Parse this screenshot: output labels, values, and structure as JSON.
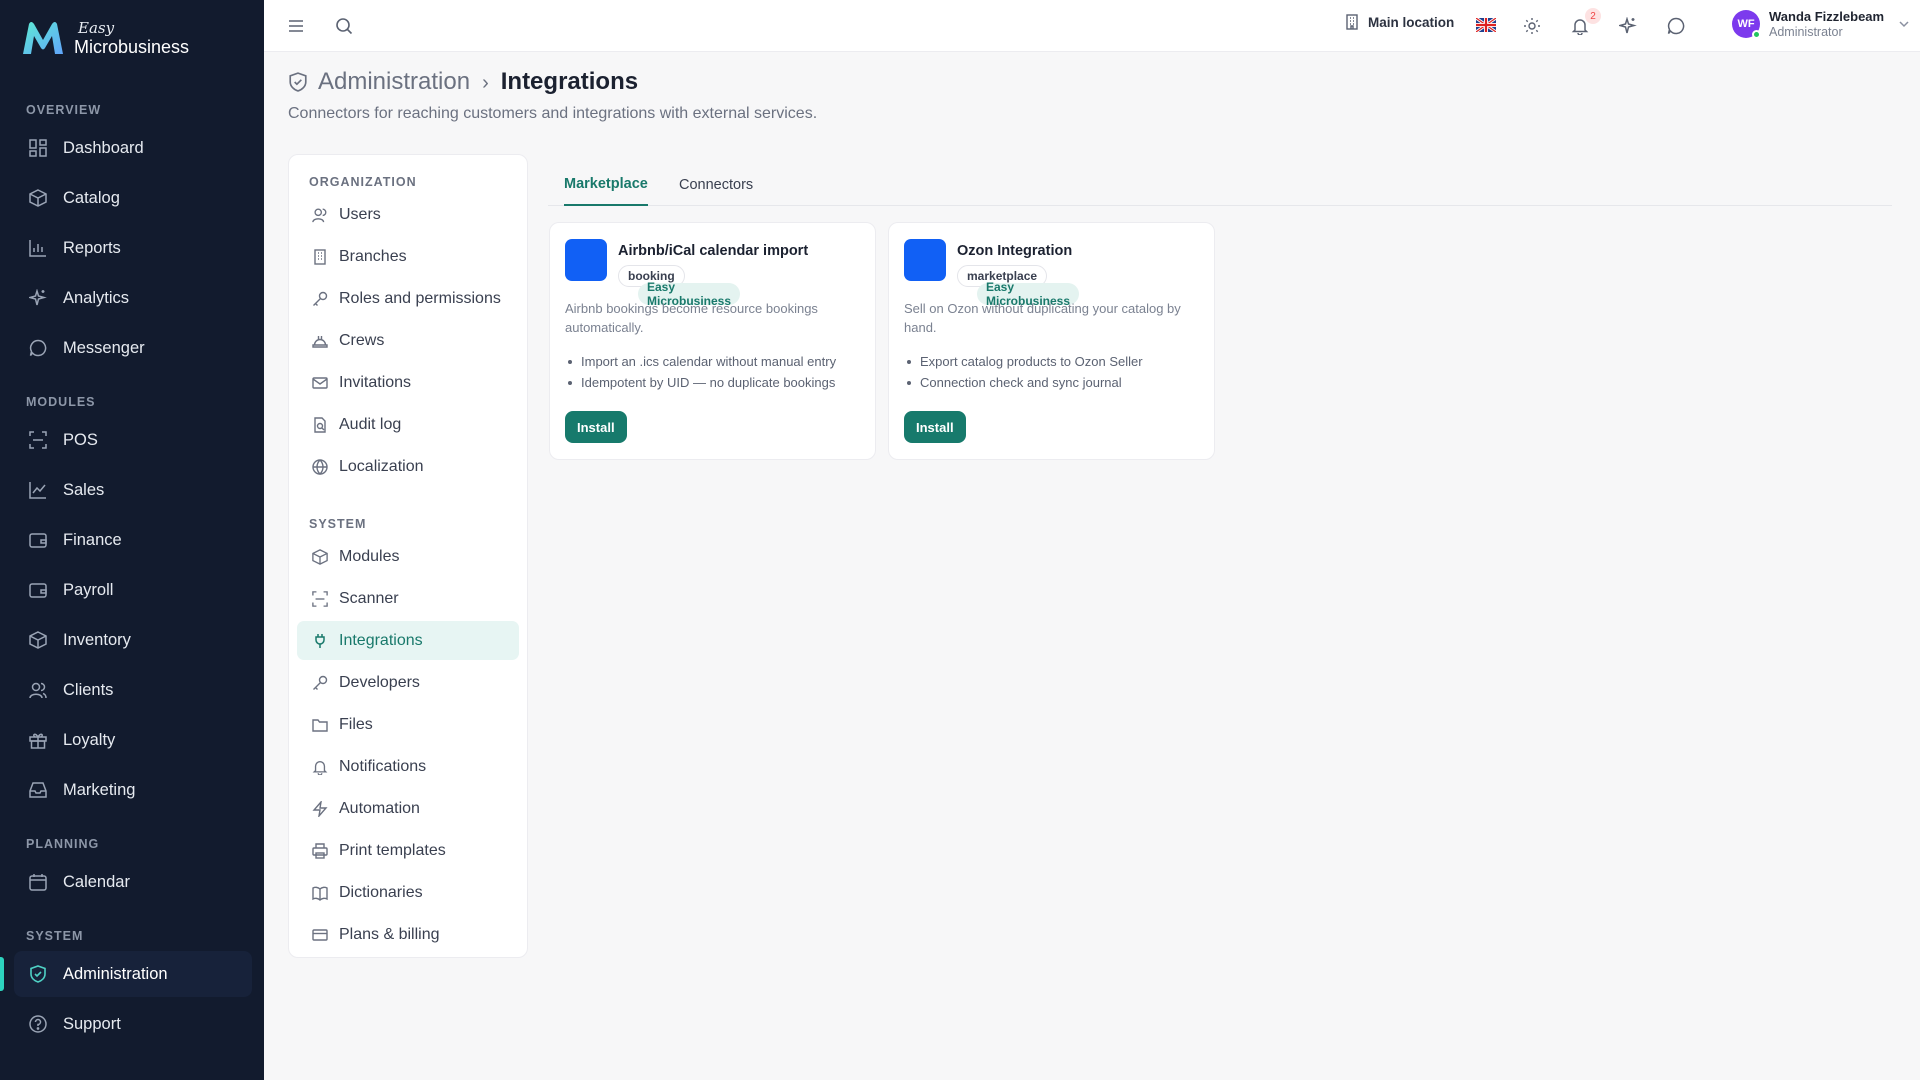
{
  "brand": {
    "small": "Easy",
    "name": "Microbusiness"
  },
  "sidebar": {
    "sections": {
      "overview": "OVERVIEW",
      "modules": "MODULES",
      "planning": "PLANNING",
      "system": "SYSTEM"
    },
    "items": [
      {
        "label": "Dashboard",
        "icon": "dashboard-icon"
      },
      {
        "label": "Catalog",
        "icon": "catalog-icon"
      },
      {
        "label": "Reports",
        "icon": "reports-icon"
      },
      {
        "label": "Analytics",
        "icon": "sparkle-icon"
      },
      {
        "label": "Messenger",
        "icon": "chat-icon"
      },
      {
        "label": "POS",
        "icon": "scan-icon"
      },
      {
        "label": "Sales",
        "icon": "chart-line-icon"
      },
      {
        "label": "Finance",
        "icon": "wallet-icon"
      },
      {
        "label": "Payroll",
        "icon": "wallet-icon"
      },
      {
        "label": "Inventory",
        "icon": "box-icon"
      },
      {
        "label": "Clients",
        "icon": "users-icon"
      },
      {
        "label": "Loyalty",
        "icon": "gift-icon"
      },
      {
        "label": "Marketing",
        "icon": "inbox-icon"
      },
      {
        "label": "Calendar",
        "icon": "calendar-icon"
      },
      {
        "label": "Administration",
        "icon": "shield-icon",
        "active": true
      },
      {
        "label": "Support",
        "icon": "help-icon"
      }
    ]
  },
  "topbar": {
    "location": "Main location",
    "notifications_count": "2",
    "user": {
      "initials": "WF",
      "name": "Wanda Fizzlebeam",
      "role": "Administrator"
    }
  },
  "page": {
    "breadcrumb_root": "Administration",
    "breadcrumb_sep": "›",
    "title": "Integrations",
    "subtitle": "Connectors for reaching customers and integrations with external services."
  },
  "subnav": {
    "sections": {
      "organization": "ORGANIZATION",
      "system": "SYSTEM"
    },
    "items": [
      {
        "label": "Users",
        "icon": "users-icon"
      },
      {
        "label": "Branches",
        "icon": "building-icon"
      },
      {
        "label": "Roles and permissions",
        "icon": "key-icon"
      },
      {
        "label": "Crews",
        "icon": "hard-hat-icon"
      },
      {
        "label": "Invitations",
        "icon": "mail-icon"
      },
      {
        "label": "Audit log",
        "icon": "audit-icon"
      },
      {
        "label": "Localization",
        "icon": "globe-icon"
      },
      {
        "label": "Modules",
        "icon": "box-icon"
      },
      {
        "label": "Scanner",
        "icon": "scan-icon"
      },
      {
        "label": "Integrations",
        "icon": "plug-icon",
        "active": true
      },
      {
        "label": "Developers",
        "icon": "key-icon"
      },
      {
        "label": "Files",
        "icon": "folder-icon"
      },
      {
        "label": "Notifications",
        "icon": "bell-icon"
      },
      {
        "label": "Automation",
        "icon": "zap-icon"
      },
      {
        "label": "Print templates",
        "icon": "printer-icon"
      },
      {
        "label": "Dictionaries",
        "icon": "book-icon"
      },
      {
        "label": "Plans & billing",
        "icon": "credit-card-icon"
      }
    ]
  },
  "tabs": [
    {
      "label": "Marketplace",
      "active": true
    },
    {
      "label": "Connectors",
      "active": false
    }
  ],
  "cards": [
    {
      "title": "Airbnb/iCal calendar import",
      "tags": [
        "Easy Microbusiness",
        "booking"
      ],
      "description": "Airbnb bookings become resource bookings automatically.",
      "features": [
        "Import an .ics calendar without manual entry",
        "Idempotent by UID — no duplicate bookings"
      ],
      "button": "Install"
    },
    {
      "title": "Ozon Integration",
      "tags": [
        "Easy Microbusiness",
        "marketplace"
      ],
      "description": "Sell on Ozon without duplicating your catalog by hand.",
      "features": [
        "Export catalog products to Ozon Seller",
        "Connection check and sync journal"
      ],
      "button": "Install"
    }
  ],
  "colors": {
    "sidebar_bg": "#121b2e",
    "accent": "#19796b",
    "accent_light": "#e7f5f3",
    "card_logo": "#1160f5",
    "active_indicator": "#2dd4bf"
  }
}
